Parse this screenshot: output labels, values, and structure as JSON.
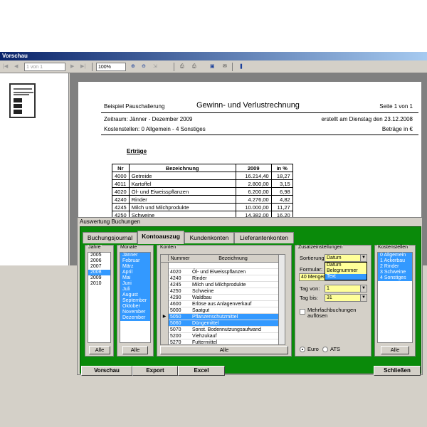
{
  "window": {
    "title": "Vorschau"
  },
  "toolbar": {
    "page_field": "1 von 1",
    "zoom": "100%"
  },
  "report": {
    "company": "Beispiel Pauschalierung",
    "title": "Gewinn- und Verlustrechnung",
    "page_info": "Seite 1 von 1",
    "period": "Zeitraum: Jänner - Dezember 2009",
    "created": "erstellt am Dienstag den 23.12.2008",
    "cost_centers": "Kostenstellen: 0 Allgemein - 4 Sonstiges",
    "currency": "Beträge in €",
    "section": "Erträge",
    "columns": [
      "Nr",
      "Bezeichnung",
      "2009",
      "in %"
    ],
    "rows": [
      [
        "4000",
        "Getreide",
        "16.214,40",
        "18,27"
      ],
      [
        "4011",
        "Kartoffel",
        "2.800,00",
        "3,15"
      ],
      [
        "4020",
        "Öl- und Eiweisspflanzen",
        "6.200,00",
        "6,98"
      ],
      [
        "4240",
        "Rinder",
        "4.276,00",
        "4,82"
      ],
      [
        "4245",
        "Milch und Milchprodukte",
        "10.000,00",
        "11,27"
      ],
      [
        "4250",
        "Schweine",
        "14.382,00",
        "16,20"
      ]
    ]
  },
  "dialog": {
    "title": "Auswertung Buchungen",
    "tabs": [
      "Buchungsjournal",
      "Kontoauszug",
      "Kundenkonten",
      "Lieferantenkonten"
    ],
    "jahre": {
      "label": "Jahre",
      "items": [
        "2005",
        "2006",
        "2007",
        "2008",
        "2009",
        "2010"
      ],
      "selected_index": 3,
      "button": "Alle"
    },
    "monate": {
      "label": "Monate",
      "items": [
        "Jänner",
        "Februar",
        "März",
        "April",
        "Mai",
        "Juni",
        "Juli",
        "August",
        "September",
        "Oktober",
        "November",
        "Dezember"
      ],
      "button": "Alle"
    },
    "konten": {
      "label": "Konten",
      "columns": [
        "Nummer",
        "Bezeichnung"
      ],
      "rows": [
        [
          "",
          "",
          false
        ],
        [
          "4020",
          "Öl- und Eiweisspflanzen",
          false
        ],
        [
          "4240",
          "Rinder",
          false
        ],
        [
          "4245",
          "Milch und Milchprodukte",
          false
        ],
        [
          "4250",
          "Schweine",
          false
        ],
        [
          "4290",
          "Waldbau",
          false
        ],
        [
          "4600",
          "Erlöse aus Anlagenverkauf",
          false
        ],
        [
          "5000",
          "Saatgut",
          false
        ],
        [
          "5050",
          "Pflanzenschutzmittel",
          true
        ],
        [
          "5060",
          "Düngemittel",
          true
        ],
        [
          "5070",
          "Sonst. Bodennutzungsaufwand",
          false
        ],
        [
          "5200",
          "Viehzukauf",
          false
        ],
        [
          "5270",
          "Futtermittel",
          false
        ]
      ],
      "button": "Alle"
    },
    "zusatz": {
      "label": "Zusatzeinstellungen",
      "sort_label": "Sortierung:",
      "sort_value": "Datum",
      "sort_options": [
        "Datum",
        "Belegnummer",
        "Text"
      ],
      "sort_highlight": 2,
      "formular_label": "Formular:",
      "formular_value": "40 Mengen",
      "tag_von_label": "Tag von:",
      "tag_von": "1",
      "tag_bis_label": "Tag bis:",
      "tag_bis": "31",
      "mehrfach_label": "Mehrfachbuchungen auflösen",
      "euro_label": "Euro",
      "ats_label": "ATS"
    },
    "kostenstellen": {
      "label": "Kostenstellen",
      "items": [
        "0 Allgemein",
        "1 Ackerbau",
        "2 Rinder",
        "3 Schweine",
        "4 Sonstiges"
      ],
      "button": "Alle"
    },
    "buttons": {
      "vorschau": "Vorschau",
      "export": "Export",
      "excel": "Excel",
      "schliessen": "Schließen"
    }
  }
}
